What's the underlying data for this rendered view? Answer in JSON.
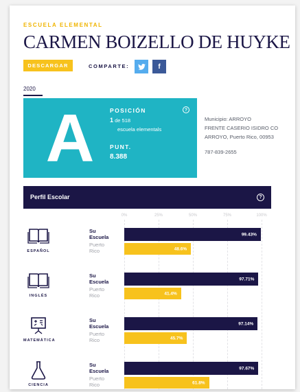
{
  "header": {
    "eyebrow": "ESCUELA ELEMENTAL",
    "title": "CARMEN BOIZELLO DE HUYKE",
    "download_label": "DESCARGAR",
    "share_label": "COMPARTE:",
    "twitter_glyph": "🐦",
    "facebook_glyph": "f",
    "year": "2020"
  },
  "grade": {
    "letter": "A",
    "position_label": "POSICIÓN",
    "position_value": "1",
    "position_of": "de 518",
    "position_sub": "escuela elementals",
    "score_label": "PUNT.",
    "score_value": "8.388",
    "help": "?"
  },
  "address": {
    "line1": "Municipio: ARROYO",
    "line2": "FRENTE CASERIO ISIDRO CO",
    "line3": "ARROYO, Puerto Rico, 00953",
    "phone": "787-839-2655"
  },
  "profile": {
    "title": "Perfil Escolar",
    "help": "?",
    "axis_ticks": [
      "0%",
      "25%",
      "50%",
      "75%",
      "100%"
    ]
  },
  "chart_data": {
    "type": "bar",
    "categories": [
      "ESPAÑOL",
      "INGLÉS",
      "MATEMÁTICA",
      "CIENCIA"
    ],
    "series": [
      {
        "name": "Su Escuela",
        "values": [
          99.43,
          97.71,
          97.14,
          97.67
        ],
        "labels": [
          "99.43%",
          "97.71%",
          "97.14%",
          "97.67%"
        ]
      },
      {
        "name": "Puerto Rico",
        "values": [
          48.6,
          41.4,
          45.7,
          61.8
        ],
        "labels": [
          "48.6%",
          "41.4%",
          "45.7%",
          "61.8%"
        ]
      }
    ],
    "ylim": [
      0,
      100
    ]
  },
  "colors": {
    "navy": "#1b1646",
    "teal": "#1fb4c4",
    "yellow": "#f7c21d"
  }
}
